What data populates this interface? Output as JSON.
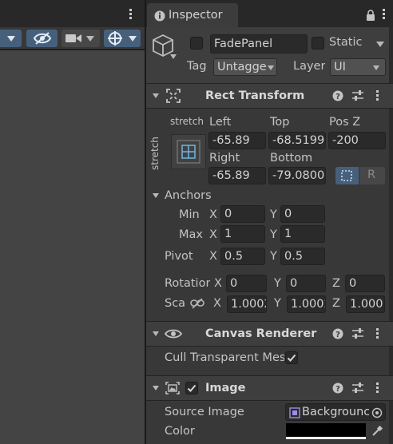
{
  "inspector": {
    "tab_label": "Inspector"
  },
  "header": {
    "object_name": "FadePanel",
    "static_label": "Static",
    "tag_label": "Tag",
    "tag_value": "Untagge",
    "layer_label": "Layer",
    "layer_value": "UI"
  },
  "rect_transform": {
    "title": "Rect Transform",
    "anchor_preset_top": "stretch",
    "anchor_preset_side": "stretch",
    "left_label": "Left",
    "top_label": "Top",
    "posz_label": "Pos Z",
    "left_value": "-65.89",
    "top_value": "-68.5199",
    "posz_value": "-200",
    "right_label": "Right",
    "bottom_label": "Bottom",
    "right_value": "-65.89",
    "bottom_value": "-79.0800",
    "raw_edit_label": "R",
    "anchors_label": "Anchors",
    "min_label": "Min",
    "max_label": "Max",
    "min_x": "0",
    "min_y": "0",
    "max_x": "1",
    "max_y": "1",
    "pivot_label": "Pivot",
    "pivot_x": "0.5",
    "pivot_y": "0.5",
    "rotation_label": "Rotatior",
    "rot_x": "0",
    "rot_y": "0",
    "rot_z": "0",
    "scale_label": "Sca",
    "scale_x": "1.0002",
    "scale_y": "1.0002",
    "scale_z": "1.000",
    "axis_x": "X",
    "axis_y": "Y",
    "axis_z": "Z"
  },
  "canvas_renderer": {
    "title": "Canvas Renderer",
    "cull_label": "Cull Transparent Mes"
  },
  "image": {
    "title": "Image",
    "source_image_label": "Source Image",
    "source_image_value": "Backgrounc",
    "color_label": "Color"
  },
  "colors": {
    "accent": "#3a79bb",
    "panel": "#383838",
    "header": "#3e3e3e",
    "field": "#2a2a2a",
    "color_swatch": "#000000"
  }
}
